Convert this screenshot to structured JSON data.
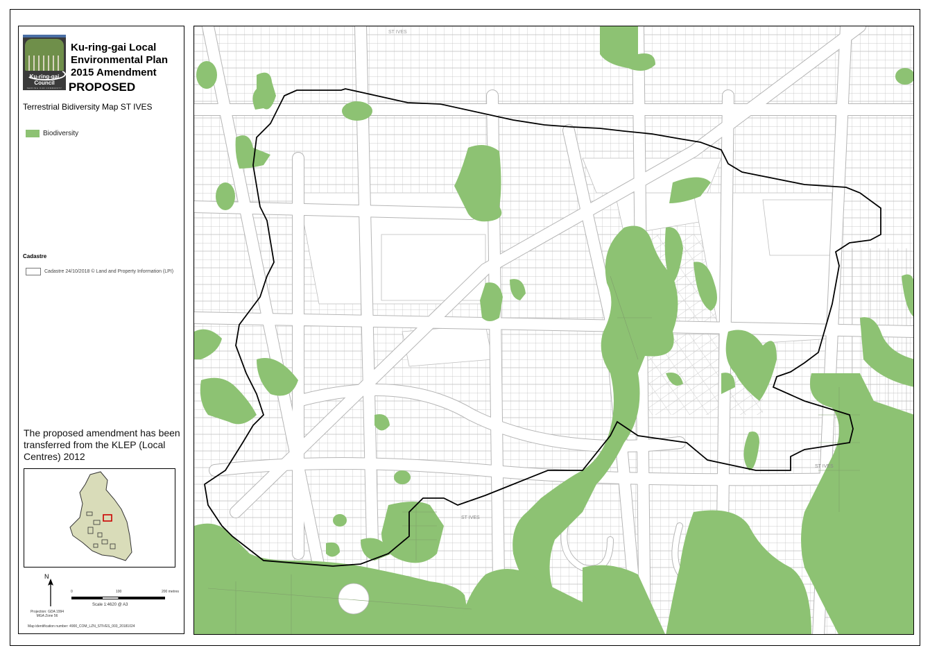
{
  "legend": {
    "logo_text_line1": "Ku-ring-gai",
    "logo_text_line2": "Council",
    "logo_subtext": "SERVING OUR COMMUNITY",
    "title_line1": "Ku-ring-gai Local",
    "title_line2": "Environmental Plan",
    "title_line3": "2015 Amendment",
    "status": "PROPOSED",
    "map_title": "Terrestrial Bidiversity Map ST IVES",
    "biodiversity_label": "Biodiversity",
    "cadastre_heading": "Cadastre",
    "cadastre_label": "Cadastre 24/10/2018 © Land and Property Information (LPI)",
    "note": "The proposed amendment has been transferred from the KLEP (Local Centres) 2012",
    "north_label": "N",
    "projection_line1": "Projection: GDA 1994",
    "projection_line2": "MGA Zone 56",
    "scale_ticks": [
      "0",
      "100",
      "200 metres"
    ],
    "scale_text": "Scale   1:4620   @ A3",
    "map_id_text": "Map identification number:   4900_COM_LZN_STIVES_003_20181024"
  },
  "map": {
    "street_labels": [
      "ST IVES",
      "ST IVES",
      "ST IVES"
    ]
  },
  "colors": {
    "biodiversity": "#8dc273",
    "cadastre": "#b5b5b5",
    "boundary": "#000000",
    "inset_lga": "#d9dcb9",
    "inset_marker": "#cc0000"
  }
}
